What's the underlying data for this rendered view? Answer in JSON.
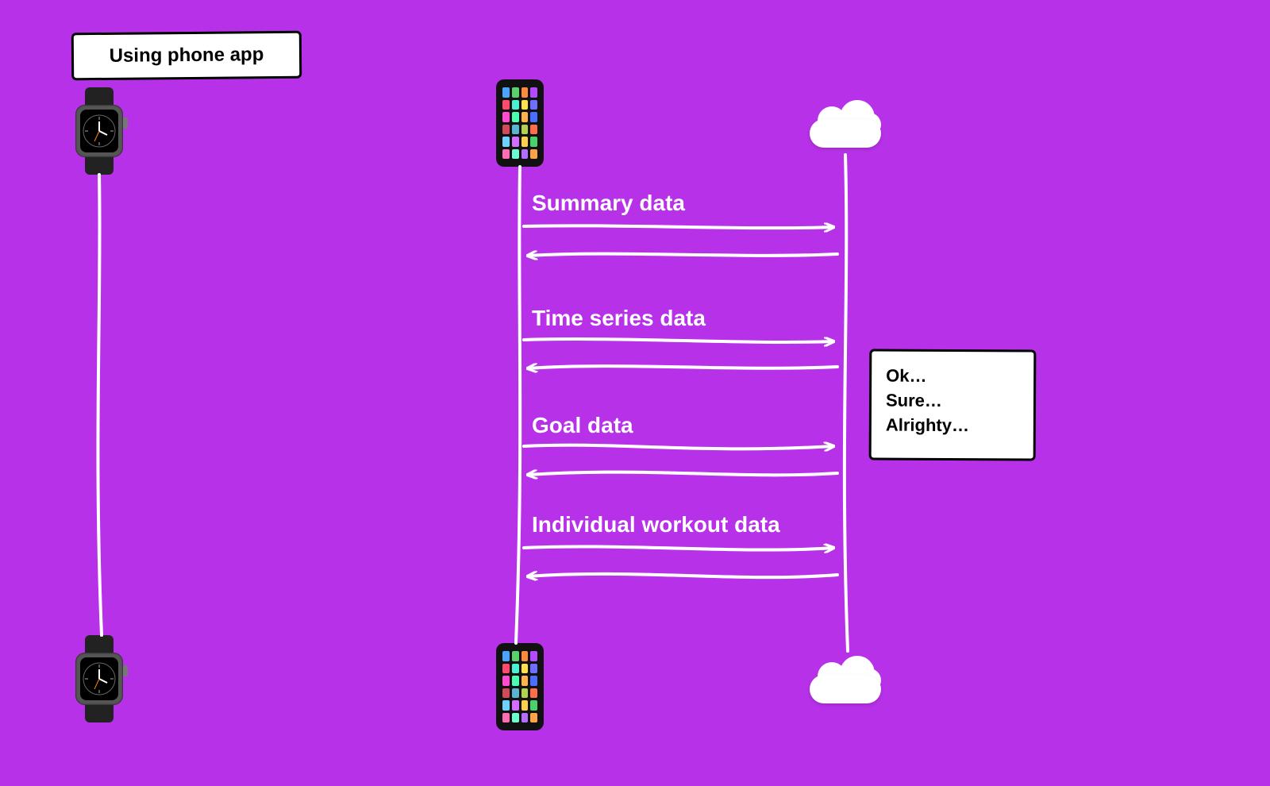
{
  "title": "Using phone app",
  "actors": {
    "watch": "watch",
    "phone": "phone",
    "cloud": "cloud"
  },
  "messages": [
    {
      "label": "Summary data"
    },
    {
      "label": "Time series data"
    },
    {
      "label": "Goal data"
    },
    {
      "label": "Individual workout data"
    }
  ],
  "response": {
    "line1": "Ok…",
    "line2": "Sure…",
    "line3": "Alrighty…"
  },
  "colors": {
    "background": "#b731e8",
    "stroke": "#ffffff",
    "box_bg": "#ffffff",
    "box_border": "#000000"
  },
  "phone_app_colors": [
    "#4aa3ff",
    "#5ad16a",
    "#ff8a3c",
    "#b44aff",
    "#ff4a6e",
    "#4af0d1",
    "#ffe14a",
    "#6e6eff",
    "#ff4ad1",
    "#4affb3",
    "#ffb34a",
    "#4a6eff",
    "#d14a5a",
    "#5ab3d1",
    "#b3d14a",
    "#ff6e4a",
    "#6ed1ff",
    "#d16eff",
    "#ffd14a",
    "#4ad16e",
    "#ff6eb3",
    "#6effd1",
    "#b36eff",
    "#ffa34a"
  ]
}
